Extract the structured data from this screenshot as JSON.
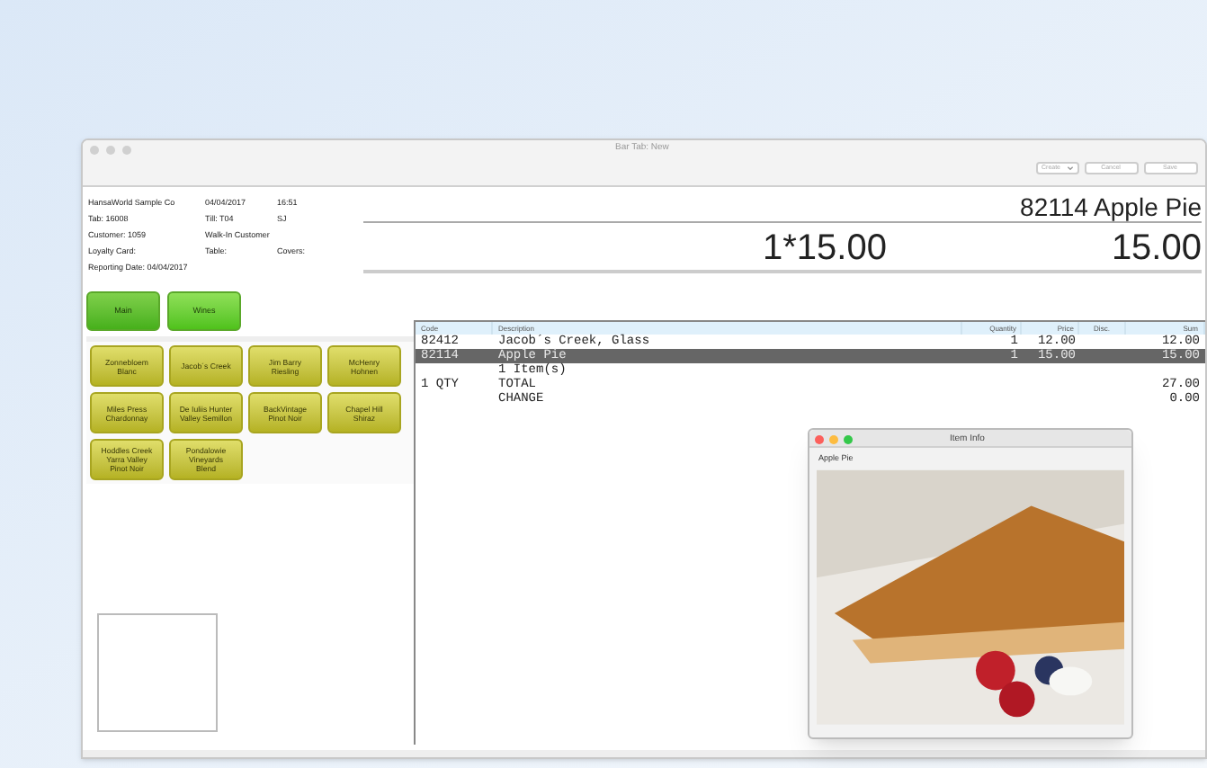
{
  "window": {
    "title": "Bar Tab: New",
    "toolbar": {
      "dropdown": "Create",
      "buttons": [
        "Cancel",
        "Save"
      ]
    }
  },
  "info": [
    [
      "HansaWorld Sample Co",
      "04/04/2017",
      "16:51"
    ],
    [
      "Tab: 16008",
      "Till: T04",
      "SJ"
    ],
    [
      "Customer: 1059",
      "Walk-In Customer"
    ],
    [
      "Loyalty Card:",
      "Table:",
      "Covers:"
    ],
    [
      "Reporting Date: 04/04/2017"
    ]
  ],
  "display": {
    "item": "82114 Apple Pie",
    "calc": "1*15.00",
    "amount": "15.00"
  },
  "categories": [
    {
      "label": "Main",
      "selected": false
    },
    {
      "label": "Wines",
      "selected": true
    }
  ],
  "products": [
    "Zonnebloem Blanc",
    "Jacob´s Creek",
    "Jim Barry Riesling",
    "McHenry Hohnen",
    "Miles Press Chardonnay",
    "De Iuliis Hunter Valley Semillon",
    "BackVintage Pinot Noir",
    "Chapel Hill Shiraz",
    "Hoddles Creek Yarra Valley Pinot Noir",
    "Pondalowie Vineyards Blend"
  ],
  "table": {
    "columns": [
      "Code",
      "Description",
      "Quantity",
      "Price",
      "Disc.",
      "Sum"
    ],
    "rows": [
      {
        "code": "82412",
        "description": "Jacob´s Creek, Glass",
        "quantity": "1",
        "price": "12.00",
        "sum": "12.00",
        "selected": false
      },
      {
        "code": "82114",
        "description": "Apple Pie",
        "quantity": "1",
        "price": "15.00",
        "sum": "15.00",
        "selected": true
      },
      {
        "description": "1 Item(s)",
        "selected": false
      },
      {
        "code": "1 QTY",
        "description": "TOTAL",
        "sum": "27.00",
        "selected": false
      },
      {
        "description": "CHANGE",
        "sum": "0.00",
        "selected": false
      }
    ]
  },
  "popup": {
    "title": "Item Info",
    "label": "Apple Pie"
  }
}
